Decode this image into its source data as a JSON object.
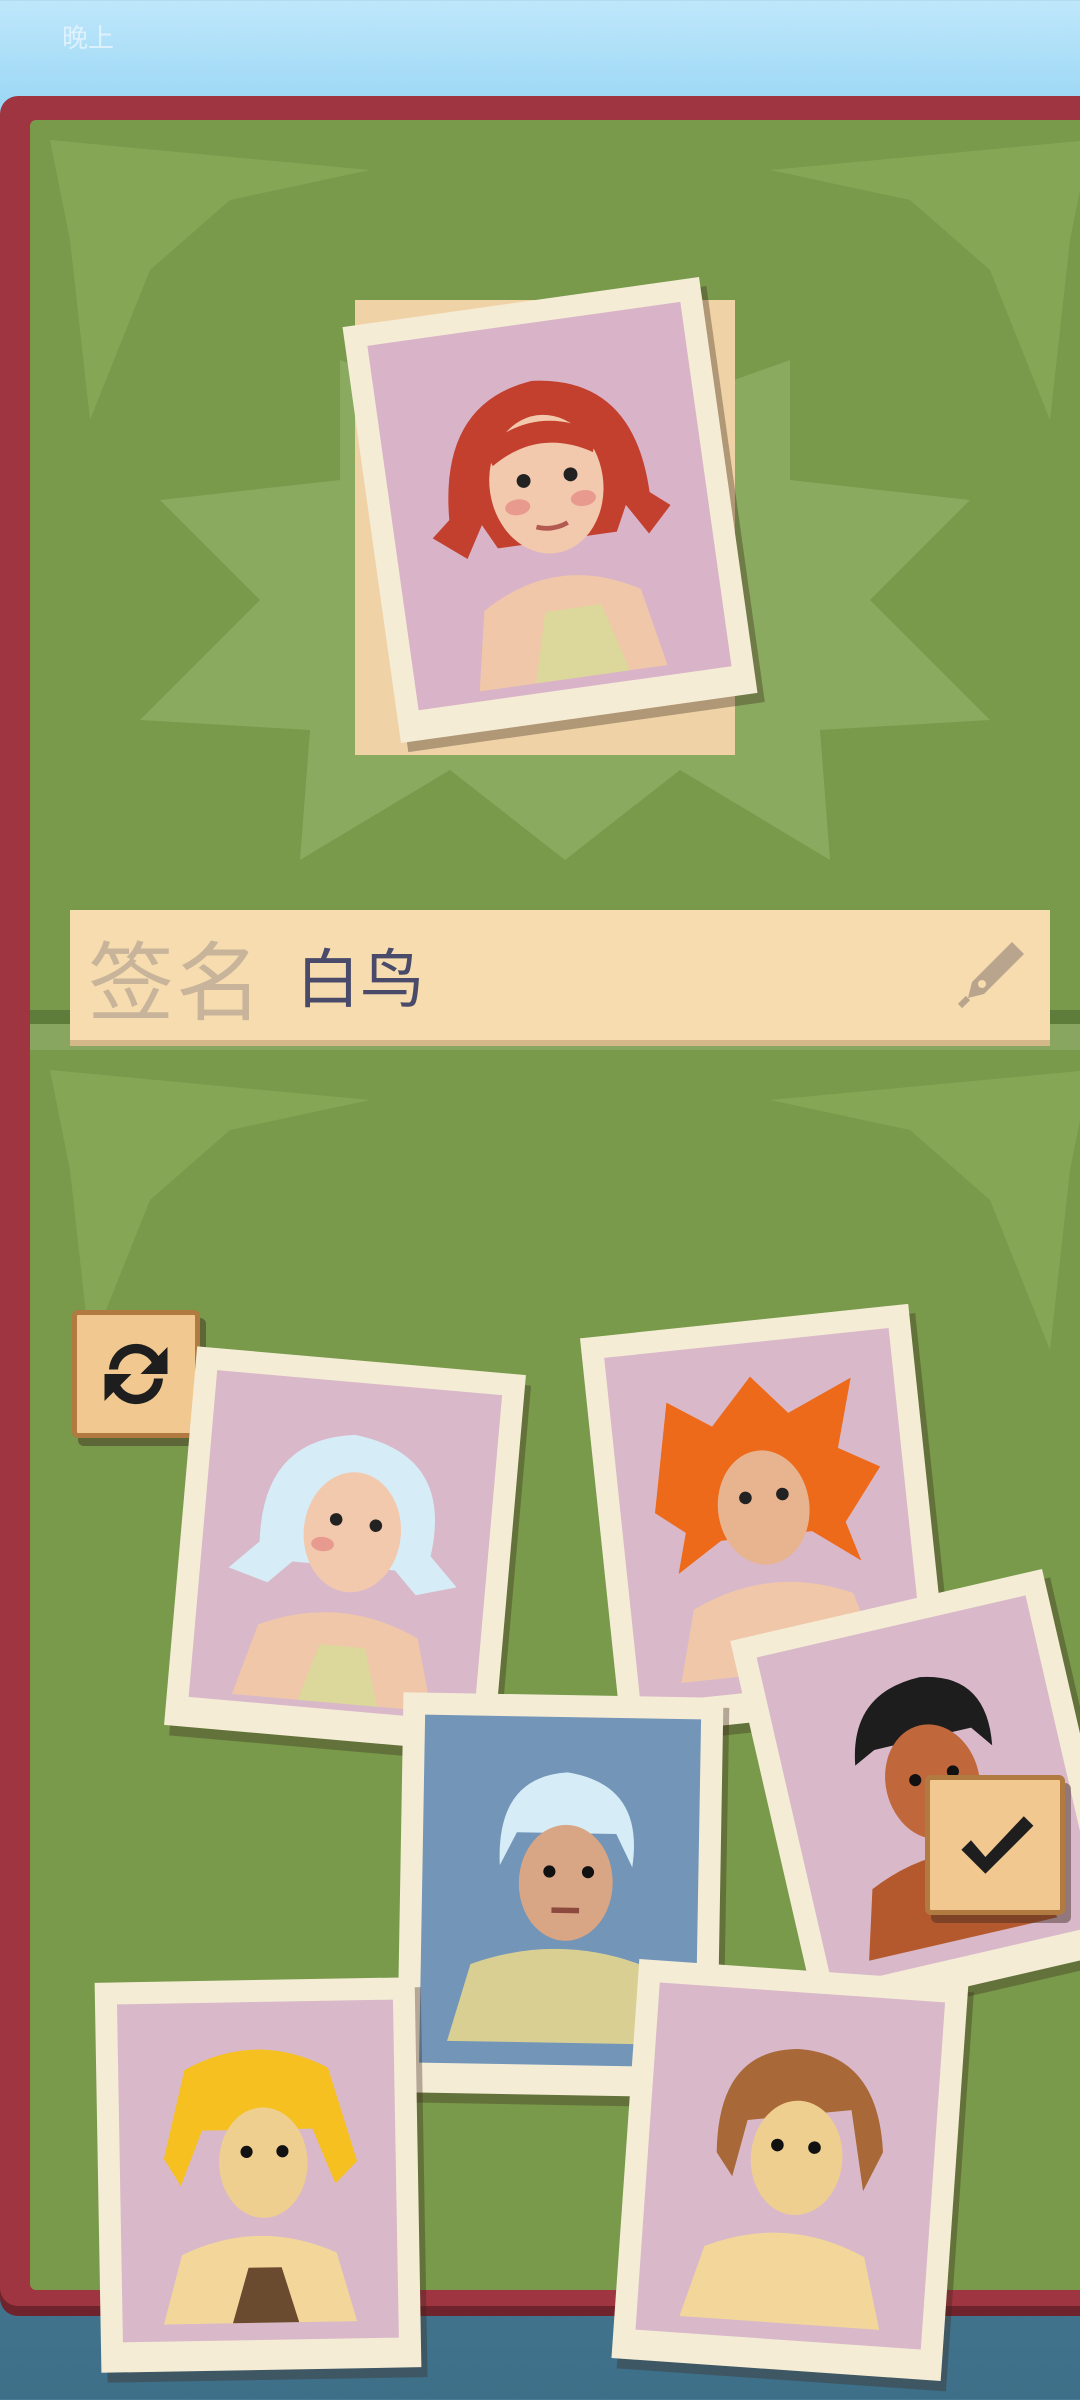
{
  "status": {
    "text": "晚上"
  },
  "signature": {
    "label": "签名",
    "name": "白鸟"
  },
  "icons": {
    "refresh": "refresh-icon",
    "confirm": "checkmark-icon",
    "pen": "pen-icon"
  },
  "colors": {
    "board": "#9e3540",
    "panel": "#789a4a",
    "sign_bar": "#f6dcae",
    "photo_bg": "#d9b9c9"
  }
}
